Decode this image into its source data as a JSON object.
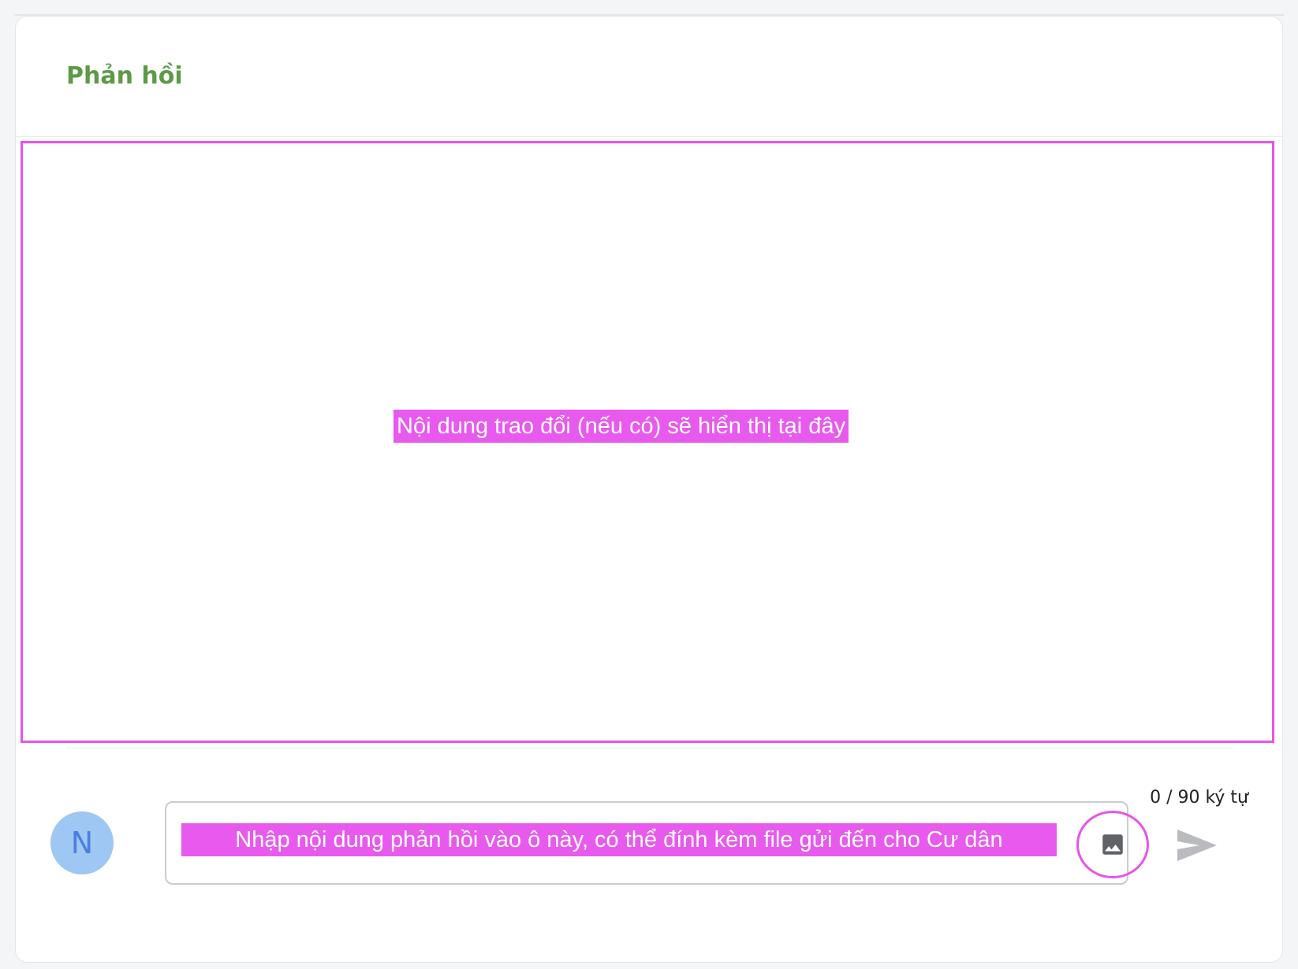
{
  "feedback": {
    "title": "Phản hồi",
    "empty_message": "Nội dung trao đổi (nếu có) sẽ hiển thị tại đây"
  },
  "composer": {
    "char_counter": "0 / 90 ký tự",
    "input_placeholder": "Nhập nội dung phản hồi vào ô này, có thể đính kèm file gửi đến cho Cư dân",
    "avatar_initial": "N",
    "attach_icon": "image-icon",
    "send_icon": "send-icon"
  },
  "colors": {
    "title_green": "#5c9a48",
    "highlight_magenta": "#e85aed",
    "avatar_bg": "#9fc7f3",
    "avatar_text": "#4b7fe2",
    "send_gray": "#b9bbbf"
  }
}
